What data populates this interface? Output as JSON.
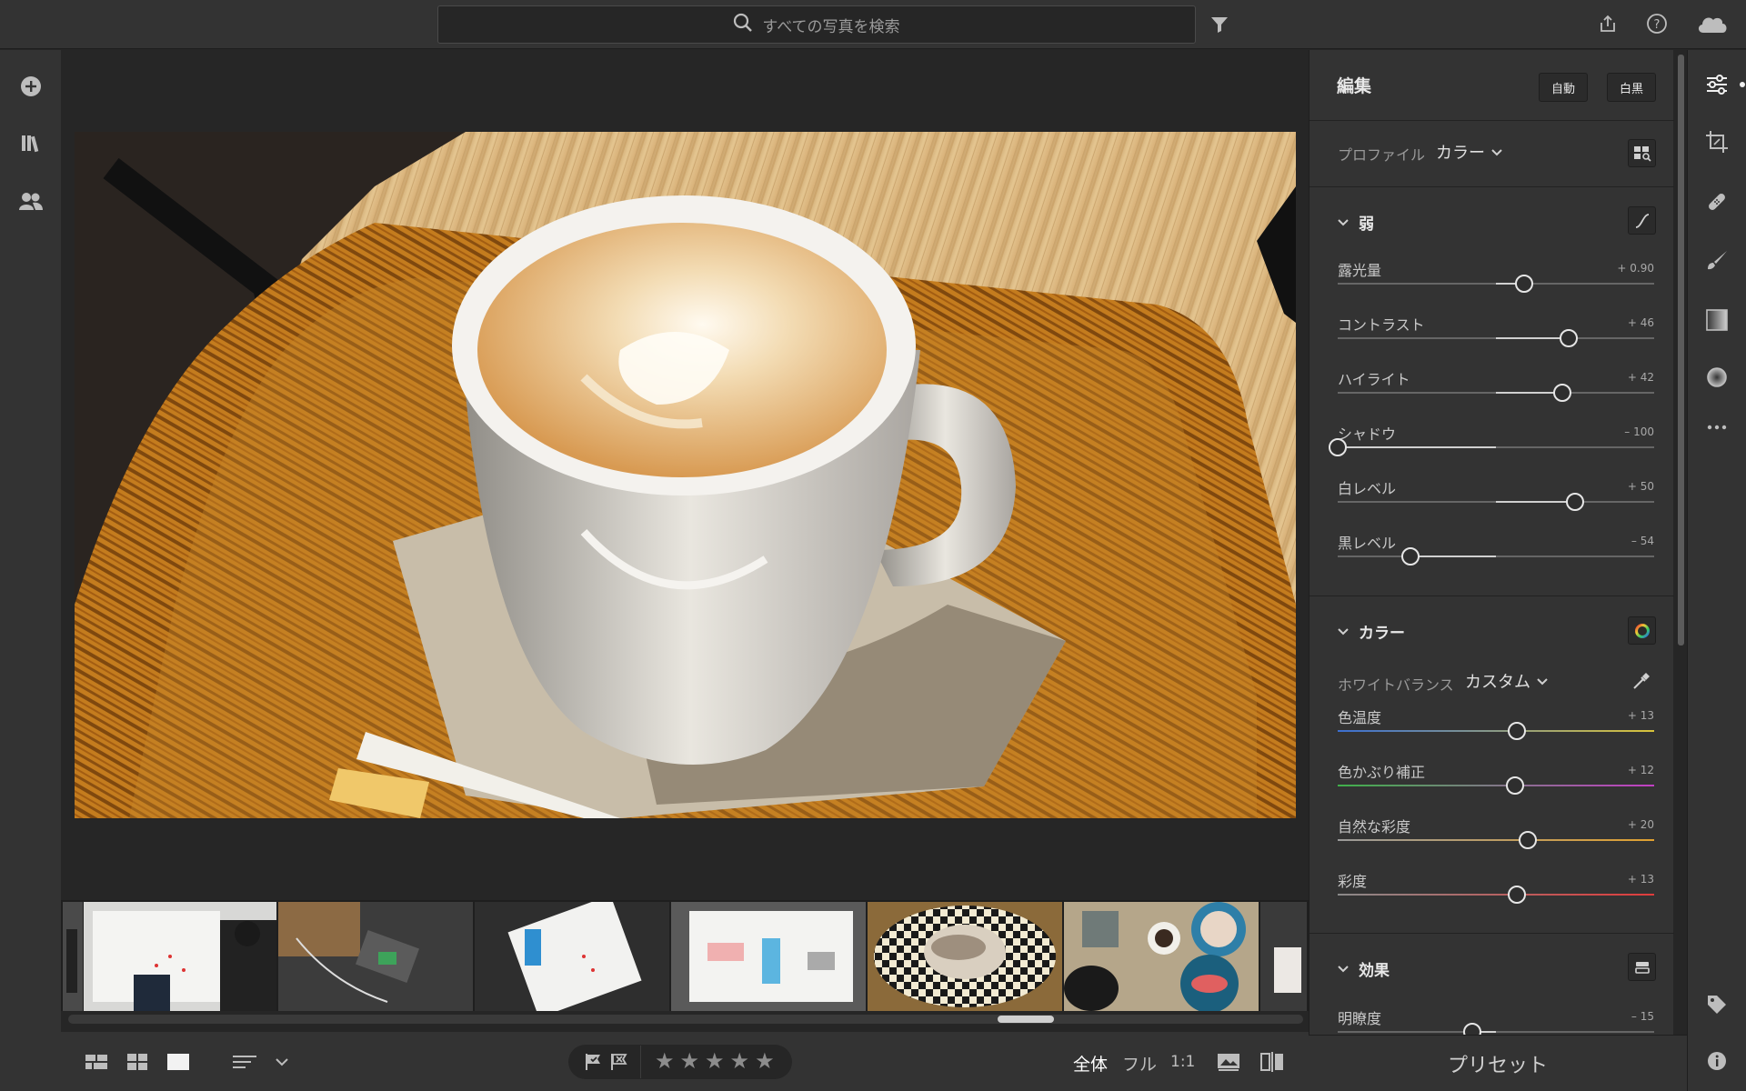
{
  "search": {
    "placeholder": "すべての写真を検索"
  },
  "edit_panel": {
    "title": "編集",
    "auto_label": "自動",
    "bw_label": "白黒",
    "profile_label": "プロファイル",
    "profile_value": "カラー",
    "sections": {
      "light": {
        "title": "弱",
        "sliders": [
          {
            "label": "露光量",
            "value_text": "+ 0.90",
            "value": 0.9,
            "min": -5,
            "max": 5
          },
          {
            "label": "コントラスト",
            "value_text": "+ 46",
            "value": 46,
            "min": -100,
            "max": 100
          },
          {
            "label": "ハイライト",
            "value_text": "+ 42",
            "value": 42,
            "min": -100,
            "max": 100
          },
          {
            "label": "シャドウ",
            "value_text": "– 100",
            "value": -100,
            "min": -100,
            "max": 100
          },
          {
            "label": "白レベル",
            "value_text": "+ 50",
            "value": 50,
            "min": -100,
            "max": 100
          },
          {
            "label": "黒レベル",
            "value_text": "– 54",
            "value": -54,
            "min": -100,
            "max": 100
          }
        ]
      },
      "color": {
        "title": "カラー",
        "wb_label": "ホワイトバランス",
        "wb_value": "カスタム",
        "sliders": [
          {
            "label": "色温度",
            "value_text": "+ 13",
            "value": 13,
            "min": -100,
            "max": 100,
            "gradient": [
              "#3b6fd1",
              "#d9c33a"
            ]
          },
          {
            "label": "色かぶり補正",
            "value_text": "+ 12",
            "value": 12,
            "min": -100,
            "max": 100,
            "gradient": [
              "#3fb04a",
              "#c23fc4"
            ]
          },
          {
            "label": "自然な彩度",
            "value_text": "+ 20",
            "value": 20,
            "min": -100,
            "max": 100,
            "gradient": [
              "#9a9a9a",
              "#e0a030"
            ]
          },
          {
            "label": "彩度",
            "value_text": "+ 13",
            "value": 13,
            "min": -100,
            "max": 100,
            "gradient": [
              "#8a8a8a",
              "#e03c3c"
            ]
          }
        ]
      },
      "effects": {
        "title": "効果",
        "sliders": [
          {
            "label": "明瞭度",
            "value_text": "– 15",
            "value": -15,
            "min": -100,
            "max": 100
          }
        ]
      }
    },
    "presets_label": "プリセット"
  },
  "bottombar": {
    "view_fit": "全体",
    "view_fill": "フル",
    "view_1to1": "1:1",
    "stars": [
      "★",
      "★",
      "★",
      "★",
      "★"
    ]
  },
  "colors": {
    "accent_slider_knob": "#e6e6e6",
    "panel_bg": "#333333",
    "canvas_bg": "#262626"
  }
}
